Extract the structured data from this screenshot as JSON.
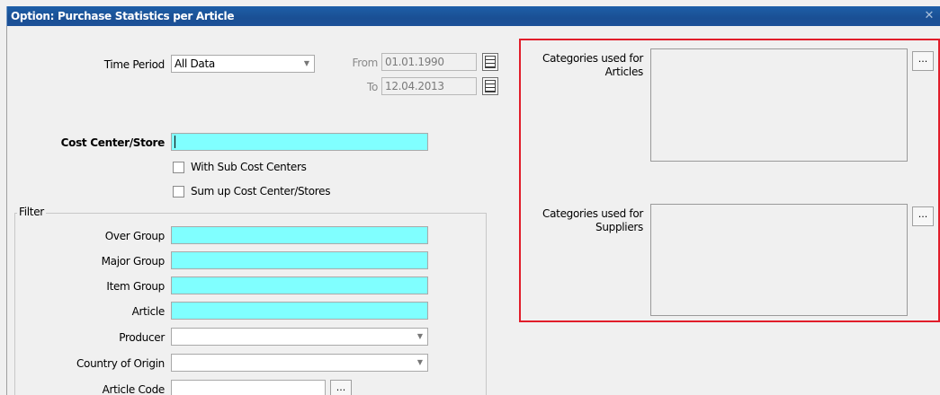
{
  "window": {
    "title": "Option: Purchase Statistics per Article",
    "close_icon": "close-icon"
  },
  "time_period": {
    "label": "Time Period",
    "value": "All Data",
    "from_label": "From",
    "from_value": "01.01.1990",
    "to_label": "To",
    "to_value": "12.04.2013"
  },
  "cost_center": {
    "label": "Cost Center/Store",
    "with_sub_label": "With Sub Cost Centers",
    "sum_up_label": "Sum up Cost Center/Stores"
  },
  "filter": {
    "legend": "Filter",
    "over_group_label": "Over Group",
    "major_group_label": "Major Group",
    "item_group_label": "Item Group",
    "article_label": "Article",
    "producer_label": "Producer",
    "country_label": "Country of Origin",
    "article_code_label": "Article Code",
    "article_code_button": "..."
  },
  "categories": {
    "articles_label_line1": "Categories used for",
    "articles_label_line2": "Articles",
    "articles_button": "...",
    "suppliers_label_line1": "Categories used for",
    "suppliers_label_line2": "Suppliers",
    "suppliers_button": "...",
    "highlight_color": "#e11d2a"
  },
  "colors": {
    "title_bar": "#1a4f94",
    "required_field": "#80ffff"
  }
}
